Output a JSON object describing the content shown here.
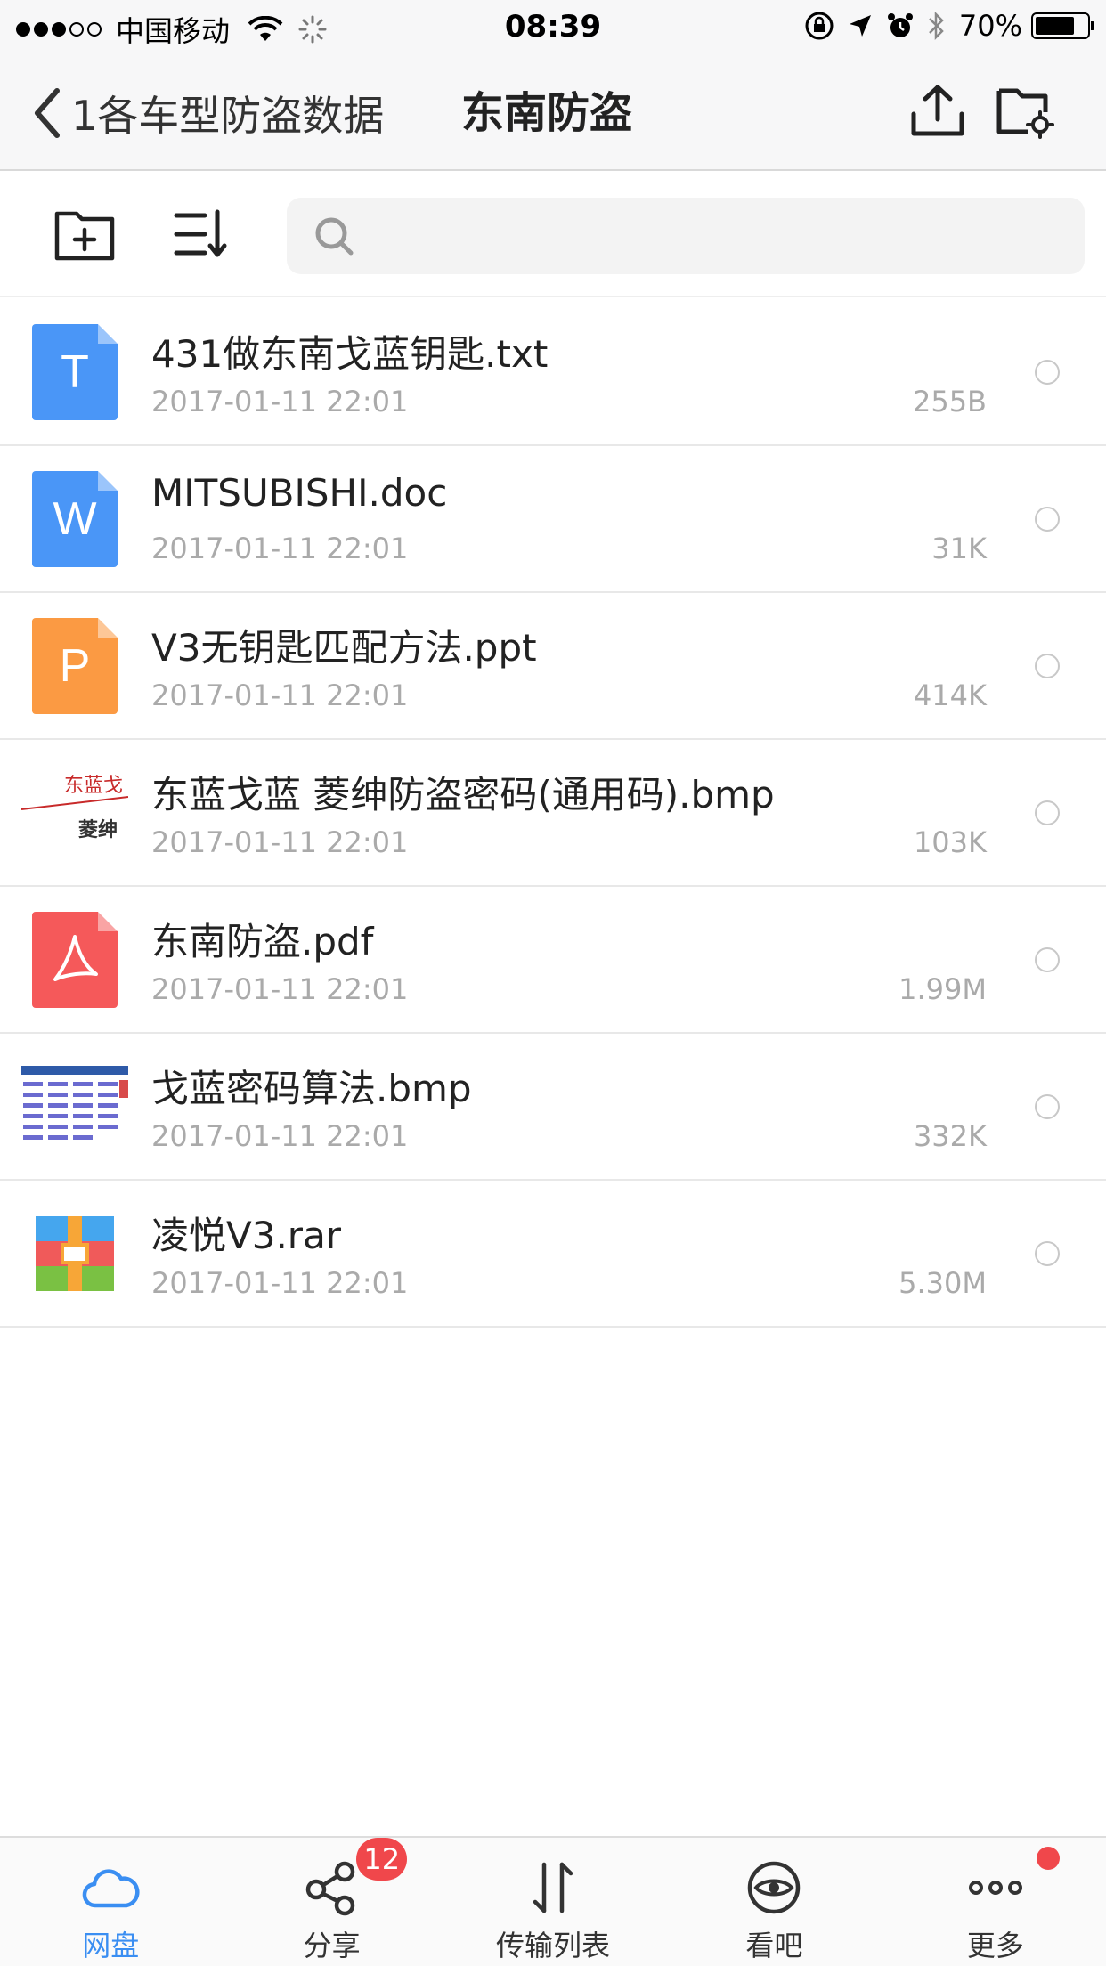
{
  "status_bar": {
    "carrier": "中国移动",
    "time": "08:39",
    "battery": "70%"
  },
  "nav": {
    "back_label": "1各车型防盗数据",
    "title": "东南防盗"
  },
  "search": {
    "placeholder": ""
  },
  "files": [
    {
      "name": "431做东南戈蓝钥匙.txt",
      "date": "2017-01-11 22:01",
      "size": "255B",
      "icon": "txt-file-icon",
      "letter": "T",
      "color": "#4a96f7"
    },
    {
      "name": "MITSUBISHI.doc",
      "date": "2017-01-11 22:01",
      "size": "31K",
      "icon": "doc-file-icon",
      "letter": "W",
      "color": "#4a96f7"
    },
    {
      "name": "V3无钥匙匹配方法.ppt",
      "date": "2017-01-11 22:01",
      "size": "414K",
      "icon": "ppt-file-icon",
      "letter": "P",
      "color": "#fb9a43"
    },
    {
      "name": "东蓝戈蓝 菱绅防盗密码(通用码).bmp",
      "date": "2017-01-11 22:01",
      "size": "103K",
      "icon": "image-thumbnail"
    },
    {
      "name": "东南防盗.pdf",
      "date": "2017-01-11 22:01",
      "size": "1.99M",
      "icon": "pdf-file-icon",
      "color": "#f5595a"
    },
    {
      "name": "戈蓝密码算法.bmp",
      "date": "2017-01-11 22:01",
      "size": "332K",
      "icon": "image-thumbnail"
    },
    {
      "name": "凌悦V3.rar",
      "date": "2017-01-11 22:01",
      "size": "5.30M",
      "icon": "rar-file-icon"
    }
  ],
  "thumb_text": {
    "img1_top": "东蓝戈",
    "img1_bottom": "菱绅"
  },
  "tabs": [
    {
      "label": "网盘",
      "icon": "cloud-icon",
      "active": true
    },
    {
      "label": "分享",
      "icon": "share-icon",
      "badge": "12"
    },
    {
      "label": "传输列表",
      "icon": "transfer-icon"
    },
    {
      "label": "看吧",
      "icon": "eye-icon"
    },
    {
      "label": "更多",
      "icon": "more-icon",
      "dot": true
    }
  ],
  "colors": {
    "accent": "#3a8ef2",
    "badge": "#f0474b"
  }
}
